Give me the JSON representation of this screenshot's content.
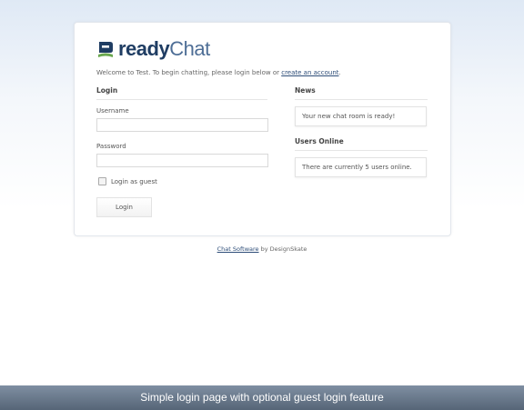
{
  "brand": {
    "name_bold": "ready",
    "name_light": "Chat"
  },
  "welcome": {
    "prefix": "Welcome to Test. To begin chatting, please login below or ",
    "link": "create an account",
    "suffix": "."
  },
  "login": {
    "title": "Login",
    "username_label": "Username",
    "username_value": "",
    "password_label": "Password",
    "password_value": "",
    "guest_label": "Login as guest",
    "guest_checked": false,
    "button_label": "Login"
  },
  "news": {
    "title": "News",
    "message": "Your new chat room is ready!"
  },
  "users_online": {
    "title": "Users Online",
    "message": "There are currently 5 users online."
  },
  "footer": {
    "link": "Chat Software",
    "suffix": " by DesignSkate"
  },
  "caption": "Simple login page with optional guest login feature",
  "colors": {
    "brand_dark": "#1f3d63",
    "brand_light": "#4e6e96",
    "logo_green": "#6aa84f",
    "caption_bar": "#667588"
  },
  "icons": {
    "logo": "readychat-logo-icon",
    "checkbox": "checkbox-icon"
  }
}
